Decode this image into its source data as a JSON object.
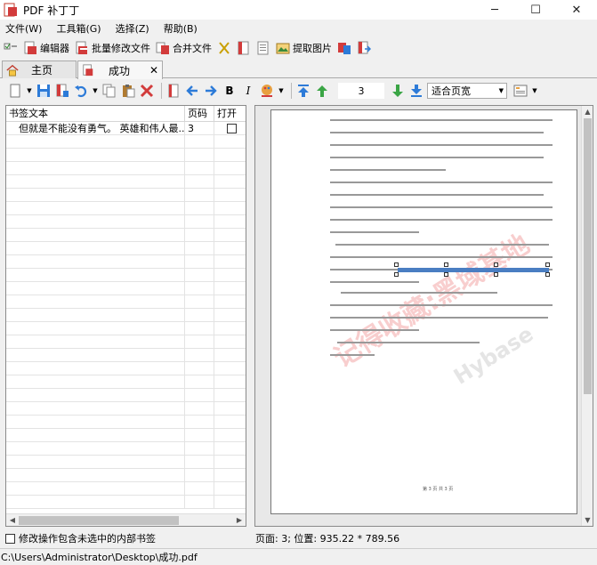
{
  "window": {
    "title": "PDF 补丁丁",
    "minimize": "─",
    "maximize": "☐",
    "close": "✕"
  },
  "menu": [
    "文件(W)",
    "工具箱(G)",
    "选择(Z)",
    "帮助(B)"
  ],
  "toolbar": {
    "editor_label": "编辑器",
    "batch_label": "批量修改文件",
    "merge_label": "合并文件",
    "extract_label": "提取图片"
  },
  "tabs": {
    "home": "主页",
    "success": "成功",
    "close": "✕"
  },
  "toolbar2": {
    "page_number": "3",
    "zoom": "适合页宽"
  },
  "bookmarks": {
    "headers": {
      "text": "书签文本",
      "page": "页码",
      "open": "打开"
    },
    "rows": [
      {
        "text": "但就是不能没有勇气。 英雄和伟人最...",
        "page": "3",
        "open": false
      }
    ],
    "empty_rows": 28
  },
  "options": {
    "include_unselected": "修改操作包含未选中的内部书签"
  },
  "preview": {
    "status": "页面: 3; 位置: 935.22 * 789.56",
    "footer": "第 3 页 共 3 页",
    "watermark1": "记得收藏:黑域基地",
    "watermark2": "Hybase"
  },
  "statusbar": {
    "path": "C:\\Users\\Administrator\\Desktop\\成功.pdf"
  },
  "colors": {
    "accent_blue": "#2d7bd8",
    "red_icon": "#d23b3b",
    "green_arrow": "#3aa545",
    "highlight": "#4a7ec2"
  }
}
